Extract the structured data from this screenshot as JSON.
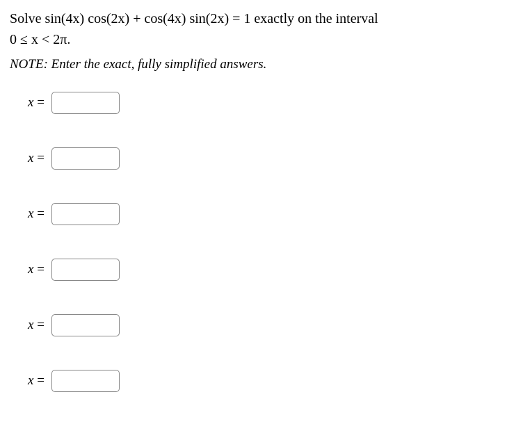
{
  "problem": {
    "line1": "Solve sin(4x) cos(2x) + cos(4x) sin(2x) = 1 exactly on the interval",
    "line2": "0 ≤ x < 2π."
  },
  "note": "NOTE: Enter the exact, fully simplified answers.",
  "answers": [
    {
      "label": "x",
      "equals": "=",
      "value": ""
    },
    {
      "label": "x",
      "equals": "=",
      "value": ""
    },
    {
      "label": "x",
      "equals": "=",
      "value": ""
    },
    {
      "label": "x",
      "equals": "=",
      "value": ""
    },
    {
      "label": "x",
      "equals": "=",
      "value": ""
    },
    {
      "label": "x",
      "equals": "=",
      "value": ""
    }
  ]
}
